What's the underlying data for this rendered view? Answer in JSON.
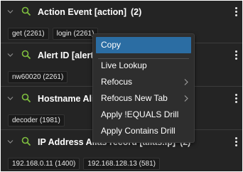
{
  "groups": [
    {
      "title": "Action Event [action]",
      "count": "(2)",
      "chips": [
        "get (2261)",
        "login (2261)"
      ]
    },
    {
      "title": "Alert ID [alert.id]",
      "count": "",
      "chips": [
        "nw60020 (2261)"
      ]
    },
    {
      "title": "Hostname Alias",
      "count": "",
      "chips": [
        "decoder (1981)"
      ]
    },
    {
      "title": "IP Address Alias record [alias.ip]",
      "count": "(2)",
      "chips": [
        "192.168.0.11 (1400)",
        "192.168.128.13 (581)"
      ]
    }
  ],
  "context_menu": {
    "items": [
      {
        "label": "Copy",
        "highlighted": true,
        "submenu": false
      },
      {
        "label": "Live Lookup",
        "highlighted": false,
        "submenu": false
      },
      {
        "label": "Refocus",
        "highlighted": false,
        "submenu": true
      },
      {
        "label": "Refocus New Tab",
        "highlighted": false,
        "submenu": true
      },
      {
        "label": "Apply !EQUALS Drill",
        "highlighted": false,
        "submenu": false
      },
      {
        "label": "Apply Contains Drill",
        "highlighted": false,
        "submenu": false
      }
    ]
  },
  "colors": {
    "panel_bg": "#242424",
    "search_icon": "#7fbf3f",
    "menu_highlight": "#2b6da3"
  },
  "icons": {
    "expand": "chevron-down-icon",
    "search": "search-icon",
    "more": "kebab-menu-icon",
    "submenu": "chevron-right-icon"
  }
}
